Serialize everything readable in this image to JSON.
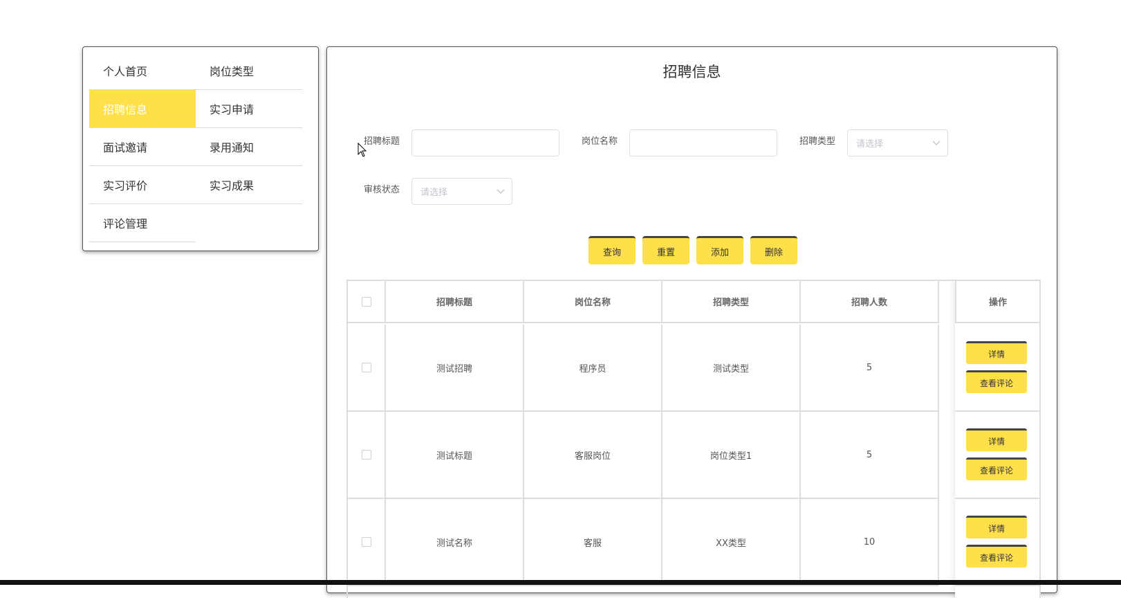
{
  "menu": {
    "items": [
      {
        "label": "个人首页"
      },
      {
        "label": "岗位类型"
      },
      {
        "label": "招聘信息",
        "active": true
      },
      {
        "label": "实习申请"
      },
      {
        "label": "面试邀请"
      },
      {
        "label": "录用通知"
      },
      {
        "label": "实习评价"
      },
      {
        "label": "实习成果"
      },
      {
        "label": "评论管理"
      }
    ]
  },
  "page": {
    "title": "招聘信息"
  },
  "search": {
    "title_label": "招聘标题",
    "title_value": "",
    "position_label": "岗位名称",
    "position_value": "",
    "type_label": "招聘类型",
    "type_placeholder": "请选择",
    "status_label": "审核状态",
    "status_placeholder": "请选择"
  },
  "buttons": {
    "query": "查询",
    "reset": "重置",
    "add": "添加",
    "delete": "删除"
  },
  "table": {
    "headers": [
      "招聘标题",
      "岗位名称",
      "招聘类型",
      "招聘人数",
      "操作"
    ],
    "rows": [
      {
        "title": "测试招聘",
        "position": "程序员",
        "type": "测试类型",
        "count": "5"
      },
      {
        "title": "测试标题",
        "position": "客服岗位",
        "type": "岗位类型1",
        "count": "5"
      },
      {
        "title": "测试名称",
        "position": "客服",
        "type": "XX类型",
        "count": "10"
      }
    ],
    "detail_label": "详情",
    "comments_label": "查看评论"
  },
  "colors": {
    "accent": "#ffe04a",
    "button_top_border": "#444444",
    "border": "#dddddd"
  }
}
